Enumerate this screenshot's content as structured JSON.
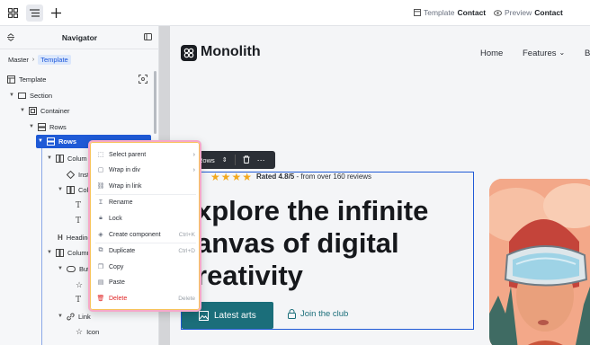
{
  "topbar": {
    "template_prefix": "Template",
    "template_name": "Contact",
    "preview_prefix": "Preview",
    "preview_name": "Contact"
  },
  "navigator": {
    "title": "Navigator",
    "breadcrumb": [
      "Master",
      "Template"
    ],
    "tree": [
      {
        "label": "Template"
      },
      {
        "label": "Section"
      },
      {
        "label": "Container"
      },
      {
        "label": "Rows"
      },
      {
        "label": "Rows"
      },
      {
        "label": "Colum"
      },
      {
        "label": "Insta"
      },
      {
        "label": "Col"
      },
      {
        "label": "Heading"
      },
      {
        "label": "Column"
      },
      {
        "label": "Butt"
      },
      {
        "label": "Link"
      },
      {
        "label": "Icon"
      }
    ]
  },
  "context_menu": {
    "items": [
      {
        "label": "Select parent",
        "shortcut": "",
        "submenu": true
      },
      {
        "label": "Wrap in div",
        "shortcut": "",
        "submenu": true
      },
      {
        "label": "Wrap in link",
        "shortcut": "",
        "submenu": false
      },
      {
        "label": "Rename",
        "shortcut": "",
        "submenu": false
      },
      {
        "label": "Lock",
        "shortcut": "",
        "submenu": false
      },
      {
        "label": "Create component",
        "shortcut": "Ctrl+K",
        "submenu": false
      },
      {
        "label": "Duplicate",
        "shortcut": "Ctrl+D",
        "submenu": false
      },
      {
        "label": "Copy",
        "shortcut": "",
        "submenu": false
      },
      {
        "label": "Paste",
        "shortcut": "",
        "submenu": false
      },
      {
        "label": "Delete",
        "shortcut": "Delete",
        "submenu": false
      }
    ]
  },
  "toolbar_chip": {
    "label": "Rows"
  },
  "site": {
    "brand": "Monolith",
    "nav": [
      "Home",
      "Features",
      "B"
    ],
    "rating_text": "Rated 4.8/5",
    "rating_suffix": " - from over 160 reviews",
    "stars": 4,
    "headline": [
      "xplore the infinite",
      "anvas of digital",
      "reativity"
    ],
    "primary_button": "Latest arts",
    "secondary_link": "Join the club"
  },
  "colors": {
    "accent": "#1f5ad6",
    "teal": "#1b6e7a",
    "star": "#f2a81d",
    "delete": "#e02424"
  }
}
